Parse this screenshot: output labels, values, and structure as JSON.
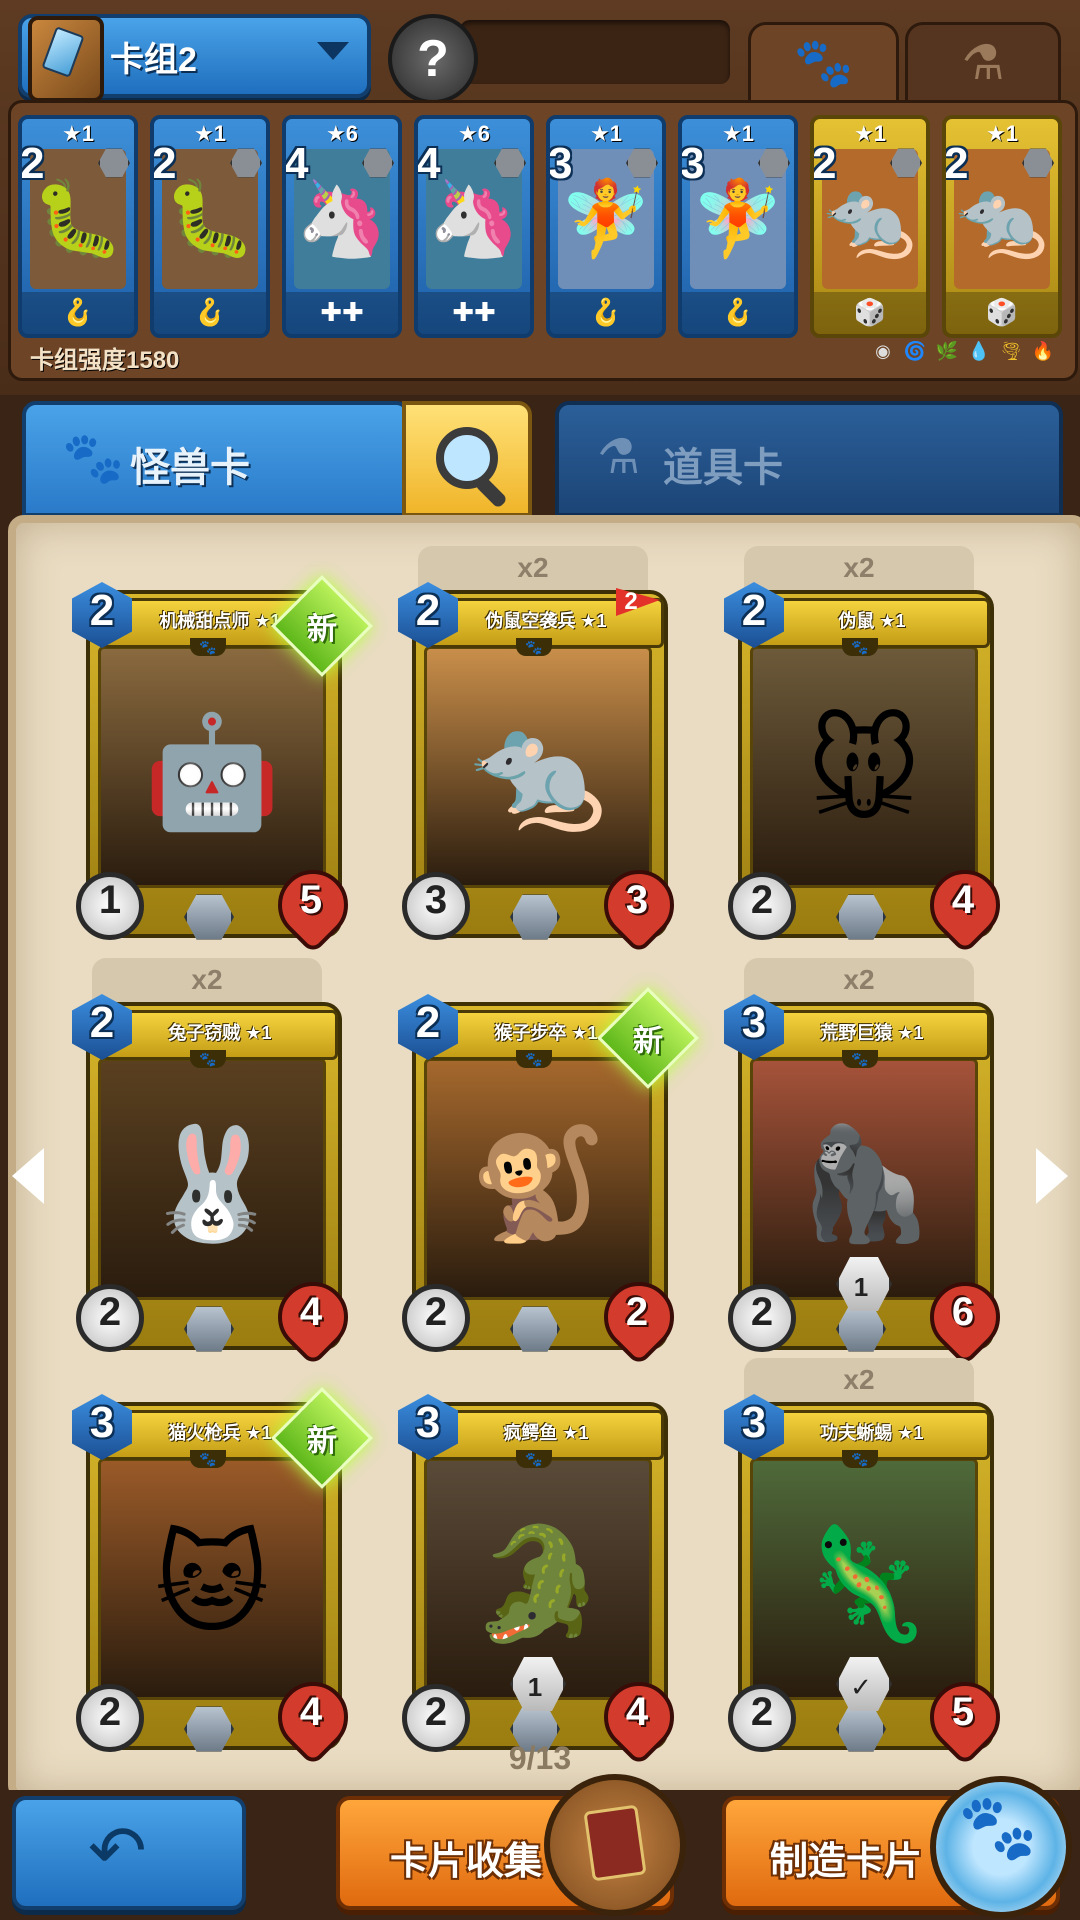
{
  "header": {
    "deck_name": "卡组2",
    "opponent_avatar_glyph": "?",
    "tab_monster_icon": "paw-icon",
    "tab_item_icon": "potion-icon"
  },
  "deck_strip": {
    "cards": [
      {
        "cost": "2",
        "stars": "★1",
        "frame": "blue",
        "art": "purple-worm-wizard",
        "foot_icon": "🪝"
      },
      {
        "cost": "2",
        "stars": "★1",
        "frame": "blue",
        "art": "purple-worm-wizard",
        "foot_icon": "🪝"
      },
      {
        "cost": "4",
        "stars": "★6",
        "frame": "blue",
        "art": "blue-armored-beast",
        "foot_icon": "✚✚"
      },
      {
        "cost": "4",
        "stars": "★6",
        "frame": "blue",
        "art": "blue-armored-beast",
        "foot_icon": "✚✚"
      },
      {
        "cost": "3",
        "stars": "★1",
        "frame": "blue",
        "art": "fairy-girl",
        "foot_icon": "🪝"
      },
      {
        "cost": "3",
        "stars": "★1",
        "frame": "blue",
        "art": "fairy-girl",
        "foot_icon": "🪝"
      },
      {
        "cost": "2",
        "stars": "★1",
        "frame": "gold",
        "art": "rat-bomber",
        "foot_icon": "🎲"
      },
      {
        "cost": "2",
        "stars": "★1",
        "frame": "gold",
        "art": "rat-bomber",
        "foot_icon": "🎲"
      }
    ],
    "deck_power_label": "卡组强度1580",
    "element_icons": [
      "◉",
      "🌀",
      "🌿",
      "💧",
      "🌪",
      "🔥"
    ]
  },
  "category_tabs": {
    "monster_label": "怪兽卡",
    "item_label": "道具卡"
  },
  "collection": {
    "cards": [
      {
        "name": "机械甜点师 ★1",
        "cost": "2",
        "attack": "1",
        "hp": "5",
        "dup": "",
        "badge": "新",
        "flag": "",
        "ability": "",
        "art": "🤖",
        "art_bg": "#8a6a3f"
      },
      {
        "name": "伪鼠空袭兵 ★1",
        "cost": "2",
        "attack": "3",
        "hp": "3",
        "dup": "x2",
        "badge": "",
        "flag": "2",
        "ability": "",
        "art": "🐀",
        "art_bg": "#c98e4a"
      },
      {
        "name": "伪鼠 ★1",
        "cost": "2",
        "attack": "2",
        "hp": "4",
        "dup": "x2",
        "badge": "",
        "flag": "",
        "ability": "",
        "art": "🐭",
        "art_bg": "#6d5a3a"
      },
      {
        "name": "兔子窃贼 ★1",
        "cost": "2",
        "attack": "2",
        "hp": "4",
        "dup": "x2",
        "badge": "",
        "flag": "",
        "ability": "",
        "art": "🐰",
        "art_bg": "#5a4020"
      },
      {
        "name": "猴子步卒 ★1",
        "cost": "2",
        "attack": "2",
        "hp": "2",
        "dup": "",
        "badge": "新",
        "flag": "",
        "ability": "",
        "art": "🐒",
        "art_bg": "#a5682d"
      },
      {
        "name": "荒野巨猿 ★1",
        "cost": "3",
        "attack": "2",
        "hp": "6",
        "dup": "x2",
        "badge": "",
        "flag": "",
        "ability": "1",
        "art": "🦍",
        "art_bg": "#a6533a"
      },
      {
        "name": "猫火枪兵 ★1",
        "cost": "3",
        "attack": "2",
        "hp": "4",
        "dup": "",
        "badge": "新",
        "flag": "",
        "ability": "",
        "art": "🐱",
        "art_bg": "#9a5a28"
      },
      {
        "name": "疯鳄鱼 ★1",
        "cost": "3",
        "attack": "2",
        "hp": "4",
        "dup": "",
        "badge": "",
        "flag": "",
        "ability": "1",
        "art": "🐊",
        "art_bg": "#5a4a38"
      },
      {
        "name": "功夫蜥蜴 ★1",
        "cost": "3",
        "attack": "2",
        "hp": "5",
        "dup": "x2",
        "badge": "",
        "flag": "",
        "ability": "✓",
        "art": "🦎",
        "art_bg": "#4f6a3a"
      }
    ],
    "page_indicator": "9/13"
  },
  "bottom_bar": {
    "back_icon": "back-arrow-icon",
    "collect_label": "卡片收集",
    "craft_label": "制造卡片"
  },
  "colors": {
    "blue_accent": "#2a7ac9",
    "gold_frame": "#d9b72b",
    "orange_button": "#e06a0f",
    "panel_bg": "#e9dcc2"
  }
}
